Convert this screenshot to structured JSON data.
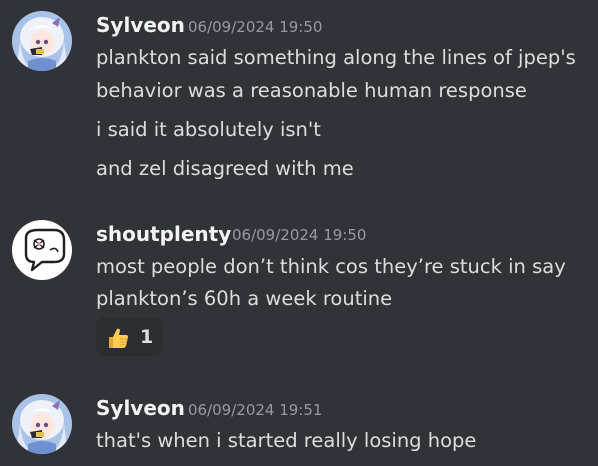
{
  "messages": [
    {
      "author": "Sylveon",
      "timestamp": "06/09/2024 19:50",
      "lines": [
        "plankton said something along the lines of jpep's",
        "behavior was a reasonable human response",
        "i said it absolutely isn't",
        "and zel disagreed with me"
      ]
    },
    {
      "author": "shoutplenty",
      "timestamp": "06/09/2024 19:50",
      "lines": [
        "most people don’t think cos they’re stuck in say",
        "plankton’s 60h a week routine"
      ],
      "reaction": {
        "icon": "thumbs-up-icon",
        "count": "1"
      }
    },
    {
      "author": "Sylveon",
      "timestamp": "06/09/2024 19:51",
      "lines": [
        "that's when i started really losing hope"
      ]
    }
  ],
  "colors": {
    "background": "#313338",
    "author": "#f2f3f5",
    "text": "#dbdee1",
    "timestamp": "#949ba4",
    "reaction_bg": "#2b2d31"
  }
}
